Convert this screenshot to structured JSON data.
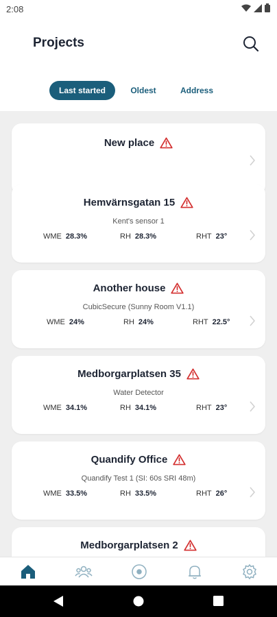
{
  "status_bar": {
    "time": "2:08"
  },
  "header": {
    "title": "Projects"
  },
  "sort_tabs": [
    {
      "label": "Last started",
      "active": true
    },
    {
      "label": "Oldest",
      "active": false
    },
    {
      "label": "Address",
      "active": false
    }
  ],
  "projects": [
    {
      "title": "New place",
      "subtitle": "",
      "warning": true,
      "metrics": []
    },
    {
      "title": "Hemvärnsgatan 15",
      "subtitle": "Kent's sensor 1",
      "warning": true,
      "metrics": [
        {
          "label": "WME",
          "value": "28.3%"
        },
        {
          "label": "RH",
          "value": "28.3%"
        },
        {
          "label": "RHT",
          "value": "23°"
        }
      ]
    },
    {
      "title": "Another house",
      "subtitle": "CubicSecure (Sunny Room V1.1)",
      "warning": true,
      "metrics": [
        {
          "label": "WME",
          "value": "24%"
        },
        {
          "label": "RH",
          "value": "24%"
        },
        {
          "label": "RHT",
          "value": "22.5°"
        }
      ]
    },
    {
      "title": "Medborgarplatsen 35",
      "subtitle": "Water Detector",
      "warning": true,
      "metrics": [
        {
          "label": "WME",
          "value": "34.1%"
        },
        {
          "label": "RH",
          "value": "34.1%"
        },
        {
          "label": "RHT",
          "value": "23°"
        }
      ]
    },
    {
      "title": "Quandify Office",
      "subtitle": "Quandify Test 1 (SI: 60s SRI 48m)",
      "warning": true,
      "metrics": [
        {
          "label": "WME",
          "value": "33.5%"
        },
        {
          "label": "RH",
          "value": "33.5%"
        },
        {
          "label": "RHT",
          "value": "26°"
        }
      ]
    },
    {
      "title": "Medborgarplatsen 2",
      "subtitle": "",
      "warning": true,
      "metrics": []
    }
  ],
  "bottom_nav": [
    {
      "icon": "home-icon",
      "active": true
    },
    {
      "icon": "people-icon",
      "active": false
    },
    {
      "icon": "sensor-icon",
      "active": false
    },
    {
      "icon": "bell-icon",
      "active": false
    },
    {
      "icon": "gear-icon",
      "active": false
    }
  ],
  "colors": {
    "accent": "#1b5e7b",
    "warning": "#d32f2f",
    "background": "#efefef"
  }
}
